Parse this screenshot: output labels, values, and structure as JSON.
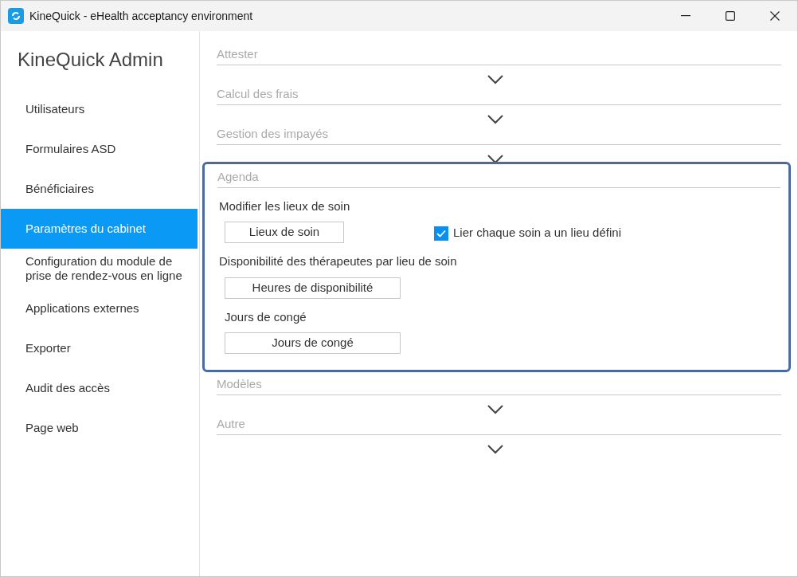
{
  "window": {
    "title": "KineQuick - eHealth acceptancy environment"
  },
  "sidebar": {
    "title": "KineQuick Admin",
    "items": [
      {
        "label": "Utilisateurs",
        "selected": false
      },
      {
        "label": "Formulaires ASD",
        "selected": false
      },
      {
        "label": "Bénéficiaires",
        "selected": false
      },
      {
        "label": "Paramètres du cabinet",
        "selected": true
      },
      {
        "label": "Configuration du module de prise de rendez-vous en ligne",
        "selected": false
      },
      {
        "label": "Applications externes",
        "selected": false
      },
      {
        "label": "Exporter",
        "selected": false
      },
      {
        "label": "Audit des accès",
        "selected": false
      },
      {
        "label": "Page web",
        "selected": false
      }
    ]
  },
  "sections": [
    {
      "title": "Attester",
      "expanded": false
    },
    {
      "title": "Calcul des frais",
      "expanded": false
    },
    {
      "title": "Gestion des impayés",
      "expanded": false
    },
    {
      "title": "Agenda",
      "expanded": true,
      "groups": [
        {
          "label": "Modifier les lieux de soin",
          "button": "Lieux de soin",
          "checkbox": {
            "label": "Lier chaque soin a un lieu défini",
            "checked": true
          }
        },
        {
          "label": "Disponibilité des thérapeutes par lieu de soin",
          "button": "Heures de disponibilité"
        },
        {
          "label": "Jours de congé",
          "button": "Jours de congé"
        }
      ]
    },
    {
      "title": "Modèles",
      "expanded": false
    },
    {
      "title": "Autre",
      "expanded": false
    }
  ]
}
